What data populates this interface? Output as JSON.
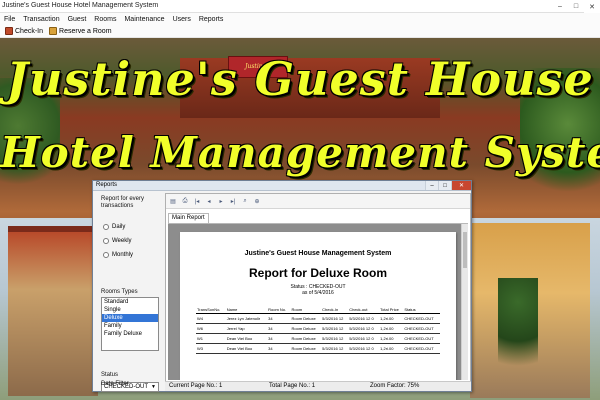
{
  "window": {
    "title": "Justine's  Guest House Hotel Management System",
    "minimize": "–",
    "maximize": "□",
    "close": "✕"
  },
  "menu": [
    "File",
    "Transaction",
    "Guest",
    "Rooms",
    "Maintenance",
    "Users",
    "Reports"
  ],
  "toolbar": {
    "checkin_label": "Check-In",
    "reserve_label": "Reserve a Room"
  },
  "banner": {
    "line1": "Justine's Guest House",
    "line2": "Hotel Management System",
    "sign_text": "Justine's",
    "text_color": "#f1ff2a"
  },
  "dialog": {
    "title": "Reports",
    "report_for_label": "Report for every transactions",
    "radios": [
      "Daily",
      "Weekly",
      "Monthly"
    ],
    "room_types_label": "Rooms Types",
    "room_types": [
      "Standard",
      "Single",
      "Deluxe",
      "Family",
      "Family Deluxe"
    ],
    "selected_room_type": "Deluxe",
    "status_label": "Status",
    "status_value": "CHECKED-OUT",
    "date_filter_label": "Date Filter"
  },
  "viewer": {
    "tab": "Main Report",
    "report": {
      "company": "Justine's  Guest House Management System",
      "title": "Report for Deluxe Room",
      "status": "Status : CHECKED-OUT",
      "as_of": "as of  5/4/2016",
      "columns": [
        "TransSonNo.",
        "Name",
        "Room No.",
        "Room",
        "Check-In",
        "Check-out",
        "Total Price",
        "Status"
      ],
      "rows": [
        [
          "W4",
          "Jerez Lyn Jatenolir",
          "34",
          "Room Deluxe",
          "5/3/2016 12",
          "5/3/2016 12 0",
          "1,2ri.00",
          "CHECKED-OUT"
        ],
        [
          "W6",
          "Jerrel Yap",
          "34",
          "Room Deluxe",
          "5/3/2016 12",
          "5/3/2016 12 0",
          "1,2ri.00",
          "CHECKED-OUT"
        ],
        [
          "W1",
          "Dean Viel Boo",
          "34",
          "Room Deluxe",
          "5/3/2016 12",
          "5/3/2016 12 0",
          "1,2ri.00",
          "CHECKED-OUT"
        ],
        [
          "W3",
          "Dean Viel Boo",
          "34",
          "Room Deluxe",
          "5/3/2016 12",
          "5/3/2016 12 0",
          "1,2ri.00",
          "CHECKED-OUT"
        ]
      ]
    },
    "status": {
      "current_page": "Current Page No.: 1",
      "total_page": "Total Page No.: 1",
      "zoom": "Zoom Factor: 75%"
    }
  }
}
